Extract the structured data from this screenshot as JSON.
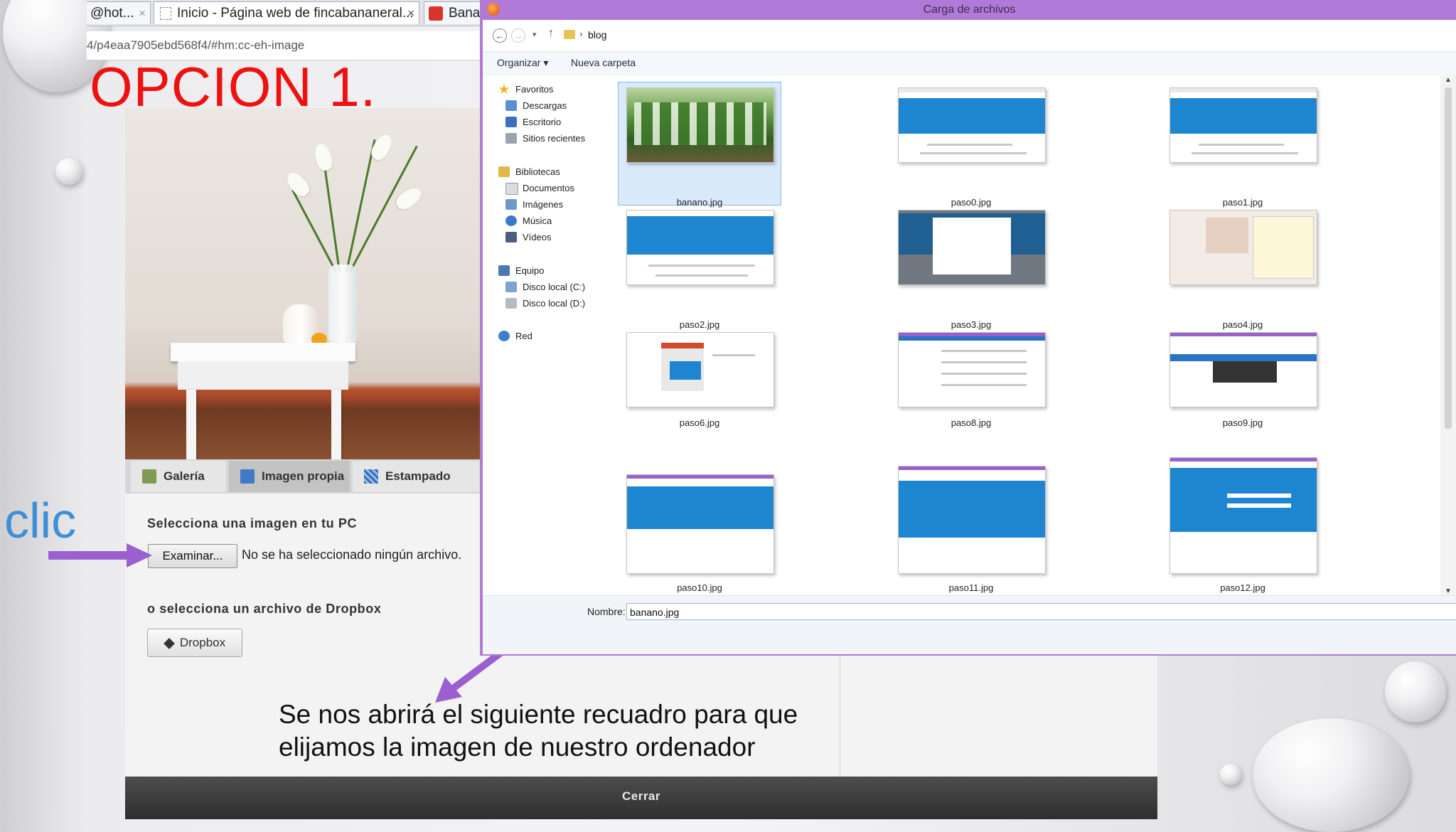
{
  "browser": {
    "tabs": [
      {
        "label": "@hot...",
        "close": "×"
      },
      {
        "label": "Inicio - Página web de fincabananeral...",
        "close": "×"
      },
      {
        "label": "Bana"
      }
    ],
    "url": "4/p4eaa7905ebd568f4/#hm:cc-eh-image"
  },
  "slide": {
    "heading": "OPCION 1.",
    "clic": "clic",
    "caption_line1": "Se nos abrirá el siguiente recuadro para que",
    "caption_line2": "elijamos la imagen de nuestro ordenador",
    "arrow_color": "#9b5fd0"
  },
  "webpage": {
    "tabs": [
      {
        "label": "Galería",
        "icon": "gallery-icon"
      },
      {
        "label": "Imagen propia",
        "icon": "own-image-icon"
      },
      {
        "label": "Estampado",
        "icon": "pattern-icon"
      }
    ],
    "select_label": "Selecciona una imagen en tu PC",
    "browse_button": "Examinar...",
    "no_file_text": "No se ha seleccionado ningún archivo.",
    "dropbox_label": "o selecciona un archivo de Dropbox",
    "dropbox_button": "Dropbox",
    "close_button": "Cerrar"
  },
  "dialog": {
    "title": "Carga de archivos",
    "breadcrumb_sep": "›",
    "folder": "blog",
    "toolbar": {
      "organize": "Organizar ▾",
      "new_folder": "Nueva carpeta"
    },
    "nav": {
      "favorites": {
        "label": "Favoritos",
        "items": [
          "Descargas",
          "Escritorio",
          "Sitios recientes"
        ]
      },
      "libraries": {
        "label": "Bibliotecas",
        "items": [
          "Documentos",
          "Imágenes",
          "Música",
          "Vídeos"
        ]
      },
      "computer": {
        "label": "Equipo",
        "items": [
          "Disco local (C:)",
          "Disco local (D:)"
        ]
      },
      "network": {
        "label": "Red"
      }
    },
    "files": [
      "banano.jpg",
      "paso0.jpg",
      "paso1.jpg",
      "paso2.jpg",
      "paso3.jpg",
      "paso4.jpg",
      "paso6.jpg",
      "paso8.jpg",
      "paso9.jpg",
      "paso10.jpg",
      "paso11.jpg",
      "paso12.jpg"
    ],
    "selected_file": "banano.jpg",
    "name_label": "Nombre:",
    "name_value": "banano.jpg",
    "accent_color": "#b17ad8"
  }
}
